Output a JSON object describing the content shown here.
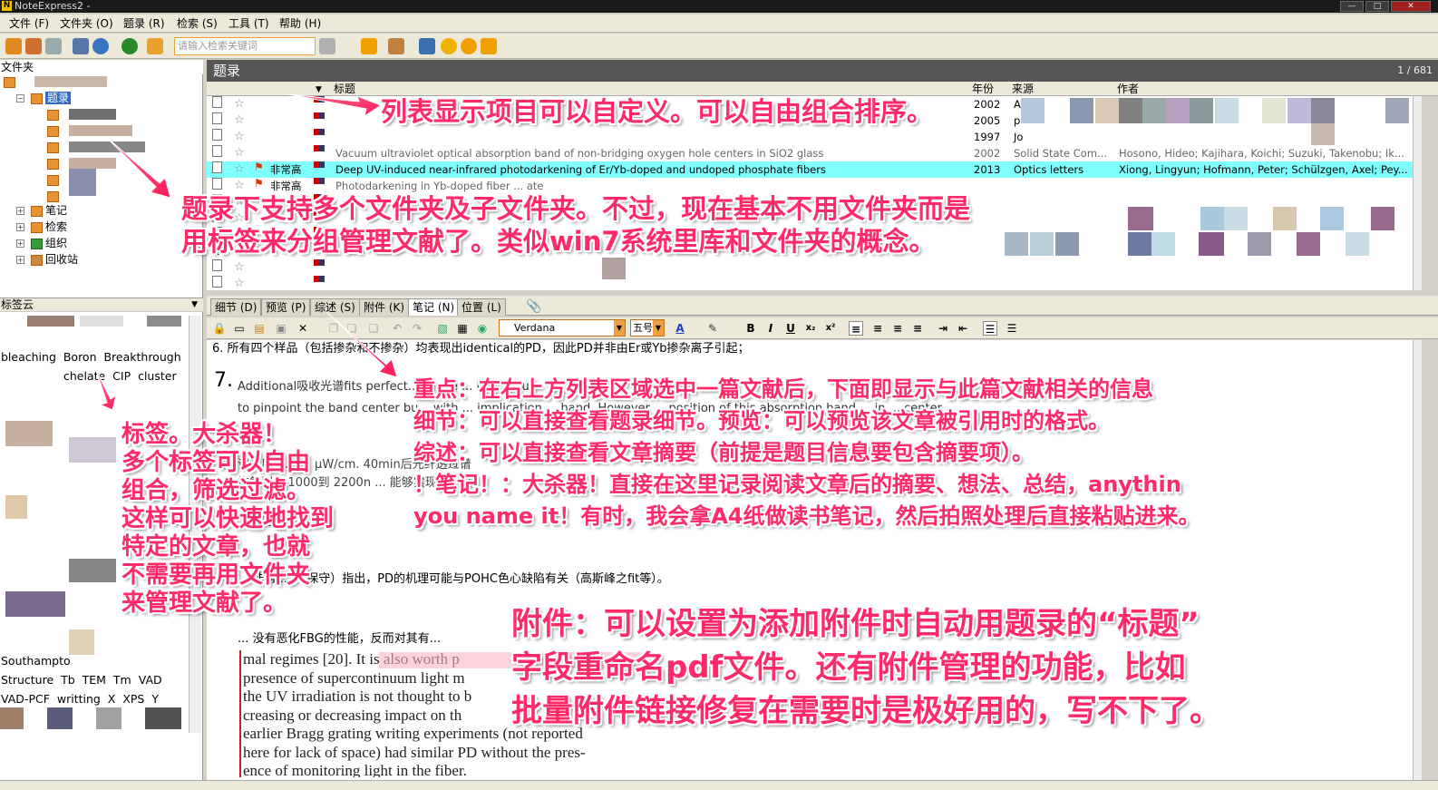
{
  "window": {
    "title": "NoteExpress2 -",
    "btn_min": "—",
    "btn_max": "□",
    "btn_close": "✕"
  },
  "menu": [
    "文件 (F)",
    "文件夹 (O)",
    "题录 (R)",
    "检索 (S)",
    "工具 (T)",
    "帮助 (H)"
  ],
  "toolbar": {
    "search_placeholder": "请输入检索关键词"
  },
  "folder_panel": {
    "header": "文件夹",
    "items": [
      "题录",
      "笔记",
      "检索",
      "组织",
      "回收站"
    ]
  },
  "tag_cloud": {
    "header": "标签云",
    "words_line1": [
      "bleaching",
      "Boron",
      "Breakthrough"
    ],
    "words_line2": [
      "chelate",
      "CIP",
      "cluster"
    ],
    "words_line3": [
      "Southampto"
    ],
    "words_line4": [
      "Structure",
      "Tb",
      "TEM",
      "Tm",
      "VAD"
    ],
    "words_line5": [
      "VAD-PCF",
      "writting",
      "X",
      "XPS",
      "Y"
    ]
  },
  "list": {
    "header": "题录",
    "page_count": "1 / 681",
    "columns": {
      "title": "标题",
      "year": "年份",
      "source": "来源",
      "author": "作者"
    },
    "rows": [
      {
        "importance": "",
        "title": "",
        "year": "2002",
        "source": "A",
        "author": ""
      },
      {
        "importance": "",
        "title": "",
        "year": "2005",
        "source": "p",
        "author": ""
      },
      {
        "importance": "",
        "title": "",
        "year": "1997",
        "source": "Jo",
        "author": ""
      },
      {
        "importance": "",
        "title": "Vacuum ultraviolet optical absorption band of non-bridging oxygen hole centers in SiO2 glass",
        "year": "2002",
        "source": "Solid State Com...",
        "author": "Hosono, Hideo; Kajihara, Koichi; Suzuki, Takenobu; Ik..."
      },
      {
        "importance": "非常高",
        "title": "Deep UV-induced near-infrared photodarkening of Er/Yb-doped and undoped phosphate fibers",
        "year": "2013",
        "source": "Optics letters",
        "author": "Xiong, Lingyun; Hofmann, Peter; Schülzgen, Axel; Pey..."
      },
      {
        "importance": "非常高",
        "title": "Photodarkening in Yb-doped fiber ... ate",
        "year": "",
        "source": "",
        "author": ""
      }
    ]
  },
  "detail_tabs": [
    "细节 (D)",
    "预览 (P)",
    "综述 (S)",
    "附件 (K)",
    "笔记 (N)",
    "位置 (L)"
  ],
  "editor_toolbar": {
    "font": "Verdana",
    "size": "五号"
  },
  "note_content": {
    "line1": "6. 所有四个样品（包括掺杂和不掺杂）均表现出identical的PD，因此PD并非由Er或Yb掺杂离子引起；",
    "line2_num": "7.",
    "line2": "Additional吸收光谱fits perfect... single ... in ... fit un",
    "line3": "to pinpoint the band center bu... with ... implication ... hand. However ... position of this absorption band ... in ... center",
    "line4": "谱之后，... ... μW/cm. 40min后光纤透过谱",
    "line5": "恢复到... 1000到 2200n ... 能够实现 ... 漂白",
    "line6": "... 漂白",
    "line7": "... 非常 ... （保守）指出，PD的机理可能与POHC色心缺陷有关（高斯峰之fit等）。",
    "line8": "... 没有恶化FBG的性能，反而对其有..."
  },
  "pdf_clip": {
    "l1": "mal regimes [20]. It is also worth p",
    "l2": "presence of supercontinuum light m",
    "l3": "the UV irradiation is not thought to b",
    "l4": "creasing or decreasing impact on th",
    "l5": "earlier Bragg grating writing experiments (not reported",
    "l6": "here for lack of space) had similar PD without the pres-",
    "l7": "ence of monitoring light in the fiber."
  },
  "annotations": {
    "a1": "列表显示项目可以自定义。可以自由组合排序。",
    "a2_l1": "题录下支持多个文件夹及子文件夹。不过，现在基本不用文件夹而是",
    "a2_l2": "用标签来分组管理文献了。类似win7系统里库和文件夹的概念。",
    "a3_l1": "标签。大杀器！",
    "a3_l2": "多个标签可以自由",
    "a3_l3": "组合，筛选过滤。",
    "a3_l4": "这样可以快速地找到",
    "a3_l5": "特定的文章，也就",
    "a3_l6": "不需要再用文件夹",
    "a3_l7": "来管理文献了。",
    "a4_l1": "重点：在右上方列表区域选中一篇文献后，下面即显示与此篇文献相关的信息",
    "a4_l2": "细节：可以直接查看题录细节。预览：可以预览该文章被引用时的格式。",
    "a4_l3": "综述：可以直接查看文章摘要（前提是题目信息要包含摘要项）。",
    "a4_l4": "！笔记！：大杀器！直接在这里记录阅读文章后的摘要、想法、总结，anythin",
    "a4_l5": "you name it！有时，我会拿A4纸做读书笔记，然后拍照处理后直接粘贴进来。",
    "a5_l1": "附件：可以设置为添加附件时自动用题录的“标题”",
    "a5_l2": "字段重命名pdf文件。还有附件管理的功能，比如",
    "a5_l3": "批量附件链接修复在需要时是极好用的，写不下了。"
  },
  "colors": {
    "annotation": "#ff2a68",
    "selected_row": "#80ffff",
    "header_bg": "#555555"
  }
}
